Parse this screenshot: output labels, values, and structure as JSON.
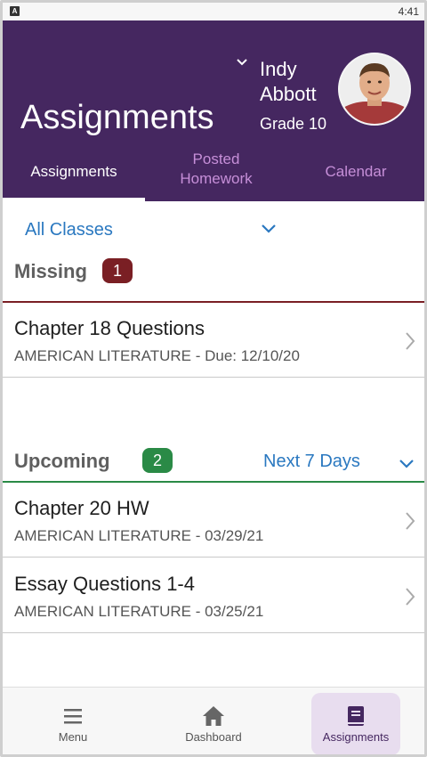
{
  "status": {
    "time": "4:41"
  },
  "header": {
    "title": "Assignments",
    "user_first": "Indy",
    "user_last": "Abbott",
    "grade": "Grade 10",
    "tabs": [
      {
        "label": "Assignments",
        "active": true
      },
      {
        "label": "Posted Homework",
        "active": false
      },
      {
        "label": "Calendar",
        "active": false
      }
    ]
  },
  "filter": {
    "label": "All Classes"
  },
  "missing": {
    "title": "Missing",
    "count": "1",
    "items": [
      {
        "title": "Chapter 18 Questions",
        "subtitle": "AMERICAN LITERATURE - Due: 12/10/20"
      }
    ]
  },
  "upcoming": {
    "title": "Upcoming",
    "count": "2",
    "range_label": "Next 7 Days",
    "items": [
      {
        "title": "Chapter 20 HW",
        "subtitle": "AMERICAN LITERATURE - 03/29/21"
      },
      {
        "title": "Essay Questions 1-4",
        "subtitle": "AMERICAN LITERATURE - 03/25/21"
      }
    ]
  },
  "bottom_nav": [
    {
      "label": "Menu",
      "icon": "menu-icon"
    },
    {
      "label": "Dashboard",
      "icon": "home-icon"
    },
    {
      "label": "Assignments",
      "icon": "book-icon",
      "active": true
    }
  ],
  "colors": {
    "header_bg": "#452760",
    "accent_blue": "#2a78c0",
    "missing_badge": "#7a1f24",
    "upcoming_badge": "#2a8a46",
    "tab_inactive": "#c68fd8"
  }
}
